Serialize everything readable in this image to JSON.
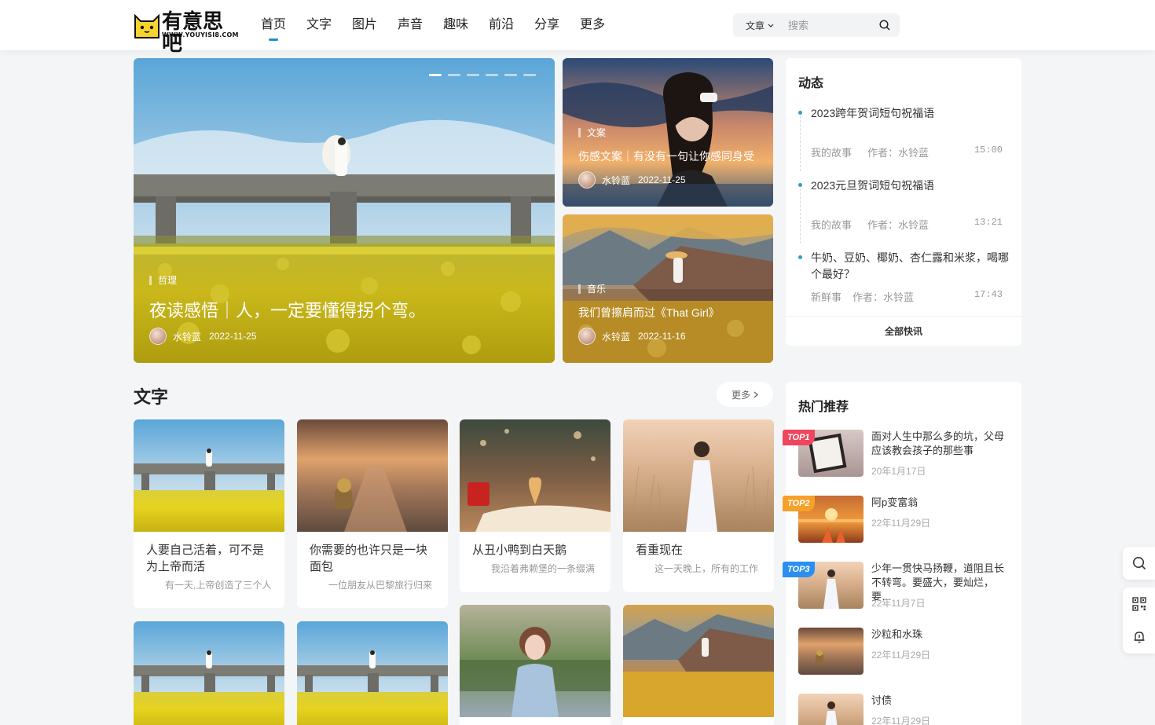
{
  "header": {
    "logo_text": "有意思吧",
    "logo_url": "WWW.YOUYISI8.COM",
    "nav": [
      "首页",
      "文字",
      "图片",
      "声音",
      "趣味",
      "前沿",
      "分享",
      "更多"
    ],
    "search": {
      "type": "文章",
      "placeholder": "搜索"
    }
  },
  "carousel": {
    "category": "哲理",
    "title": "夜读感悟｜人，一定要懂得拐个弯。",
    "author": "水铃蓝",
    "date": "2022-11-25",
    "slides": 6
  },
  "side_cards": [
    {
      "category": "文案",
      "title": "伤感文案｜有没有一句让你感同身受",
      "author": "水铃蓝",
      "date": "2022-11-25"
    },
    {
      "category": "音乐",
      "title": "我们曾擦肩而过《That Girl》",
      "author": "水铃蓝",
      "date": "2022-11-16"
    }
  ],
  "dynamics": {
    "title": "动态",
    "items": [
      {
        "title": "2023跨年贺词短句祝福语",
        "category": "我的故事",
        "author": "作者：水铃蓝",
        "time": "15:00"
      },
      {
        "title": "2023元旦贺词短句祝福语",
        "category": "我的故事",
        "author": "作者：水铃蓝",
        "time": "13:21"
      },
      {
        "title": "牛奶、豆奶、椰奶、杏仁露和米浆，喝哪个最好？",
        "category": "新鲜事",
        "author": "作者：水铃蓝",
        "time": "17:43"
      }
    ],
    "all_label": "全部快讯"
  },
  "text_section": {
    "title": "文字",
    "more": "更多",
    "cards": [
      {
        "title": "人要自己活着，可不是为上帝而活",
        "desc": "有一天,上帝创造了三个人"
      },
      {
        "title": "你需要的也许只是一块面包",
        "desc": "一位朋友从巴黎旅行归来"
      },
      {
        "title": "从丑小鸭到白天鹅",
        "desc": "我沿着弗赖堡的一条缀满"
      },
      {
        "title": "看重现在",
        "desc": "这一天晚上，所有的工作"
      }
    ]
  },
  "hot": {
    "title": "热门推荐",
    "items": [
      {
        "badge": "TOP1",
        "title": "面对人生中那么多的坑，父母应该教会孩子的那些事",
        "date": "20年1月17日"
      },
      {
        "badge": "TOP2",
        "title": "阿p变富翁",
        "date": "22年11月29日"
      },
      {
        "badge": "TOP3",
        "title": "少年一贯快马扬鞭，道阻且长不转弯。要盛大，要灿烂，要…",
        "date": "22年11月7日"
      },
      {
        "badge": "",
        "title": "沙粒和水珠",
        "date": "22年11月29日"
      },
      {
        "badge": "",
        "title": "讨债",
        "date": "22年11月29日"
      }
    ]
  },
  "colors": {
    "accent": "#1e90c7",
    "top1": "#f0455d",
    "top2": "#f7a02a",
    "top3": "#2a8ff0"
  }
}
